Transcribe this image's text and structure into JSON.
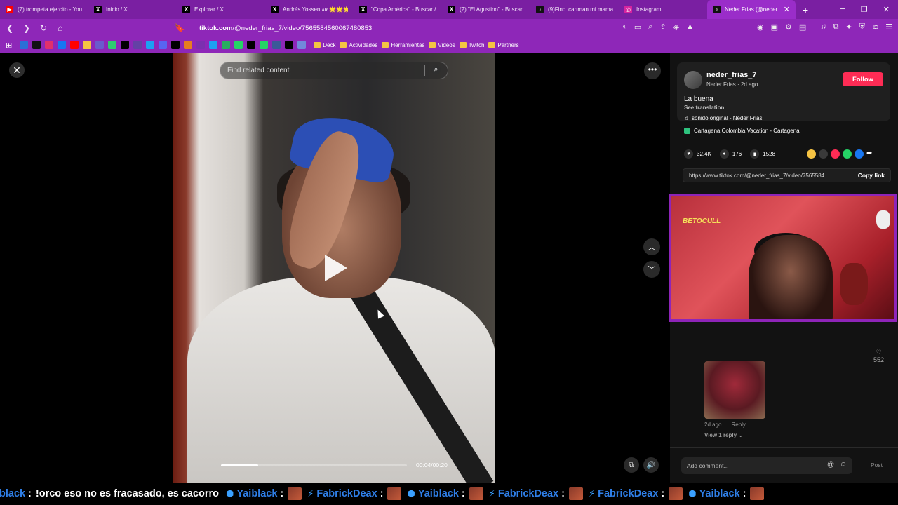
{
  "tabs": [
    {
      "title": "(7) trompeta ejercito - You",
      "fav_color": "#ff0000",
      "fav_glyph": "▶"
    },
    {
      "title": "Inicio / X",
      "fav_color": "#000000",
      "fav_glyph": "X"
    },
    {
      "title": "Explorar / X",
      "fav_color": "#000000",
      "fav_glyph": "X"
    },
    {
      "title": "Andrés Yossen ᴀʀ 🌟🌟🌟",
      "fav_color": "#000000",
      "fav_glyph": "X"
    },
    {
      "title": "\"Copa América\" - Buscar /",
      "fav_color": "#000000",
      "fav_glyph": "X"
    },
    {
      "title": "(2) \"El Agustino\" - Buscar",
      "fav_color": "#000000",
      "fav_glyph": "X"
    },
    {
      "title": "(9)Find 'cartman mi mama",
      "fav_color": "#111111",
      "fav_glyph": "♪"
    },
    {
      "title": "Instagram",
      "fav_color": "#d6249f",
      "fav_glyph": "◎"
    },
    {
      "title": "Neder Frias (@neder",
      "fav_color": "#111111",
      "fav_glyph": "♪",
      "active": true
    }
  ],
  "address": {
    "domain": "tiktok.com",
    "path": "/@neder_frias_7/video/7565584560067480853"
  },
  "bookmarks": {
    "folders": [
      "Deck",
      "Actividades",
      "Herramientas",
      "Videos",
      "Twitch",
      "Partners"
    ],
    "icon_colors": [
      "#2a6fd6",
      "#111111",
      "#e1306c",
      "#1877f2",
      "#ff0000",
      "#f6c343",
      "#6a5acd",
      "#2ecc71",
      "#000000",
      "#6441a5",
      "#1da1f2",
      "#5865f2",
      "#000000",
      "#e67e22",
      "#7b2fb0",
      "#1da1f2",
      "#27ae60",
      "#25d366",
      "#000000",
      "#25d366",
      "#3b5998",
      "#000000",
      "#7289da"
    ]
  },
  "video": {
    "search_placeholder": "Find related content",
    "progress": 0.2,
    "time": "00:04/00:20"
  },
  "post": {
    "username": "neder_frias_7",
    "subline": "Neder Frias · 2d ago",
    "follow": "Follow",
    "caption": "La buena",
    "see_translation": "See translation",
    "music": "sonido original - Neder Frias",
    "location": "Cartagena Colombia Vacation - Cartagena",
    "likes": "32.4K",
    "comments": "176",
    "saves": "1528",
    "link": "https://www.tiktok.com/@neder_frias_7/video/7565584...",
    "copy_link": "Copy link"
  },
  "comment": {
    "likes": "552",
    "time": "2d ago",
    "reply": "Reply",
    "view_replies": "View 1 reply"
  },
  "comment_bar": {
    "placeholder": "Add comment...",
    "post": "Post"
  },
  "stream_overlay": {
    "logo": "BETOCULL"
  },
  "ticker": [
    {
      "name": "Yaiblack",
      "msg": "!orco eso no es fracasado, es cacorro",
      "partial": true
    },
    {
      "name": "Yaiblack",
      "msg": ""
    },
    {
      "name": "FabrickDeax",
      "msg": ""
    },
    {
      "name": "Yaiblack",
      "msg": ""
    },
    {
      "name": "FabrickDeax",
      "msg": ""
    },
    {
      "name": "FabrickDeax",
      "msg": ""
    },
    {
      "name": "Yaiblack",
      "msg": ""
    }
  ]
}
